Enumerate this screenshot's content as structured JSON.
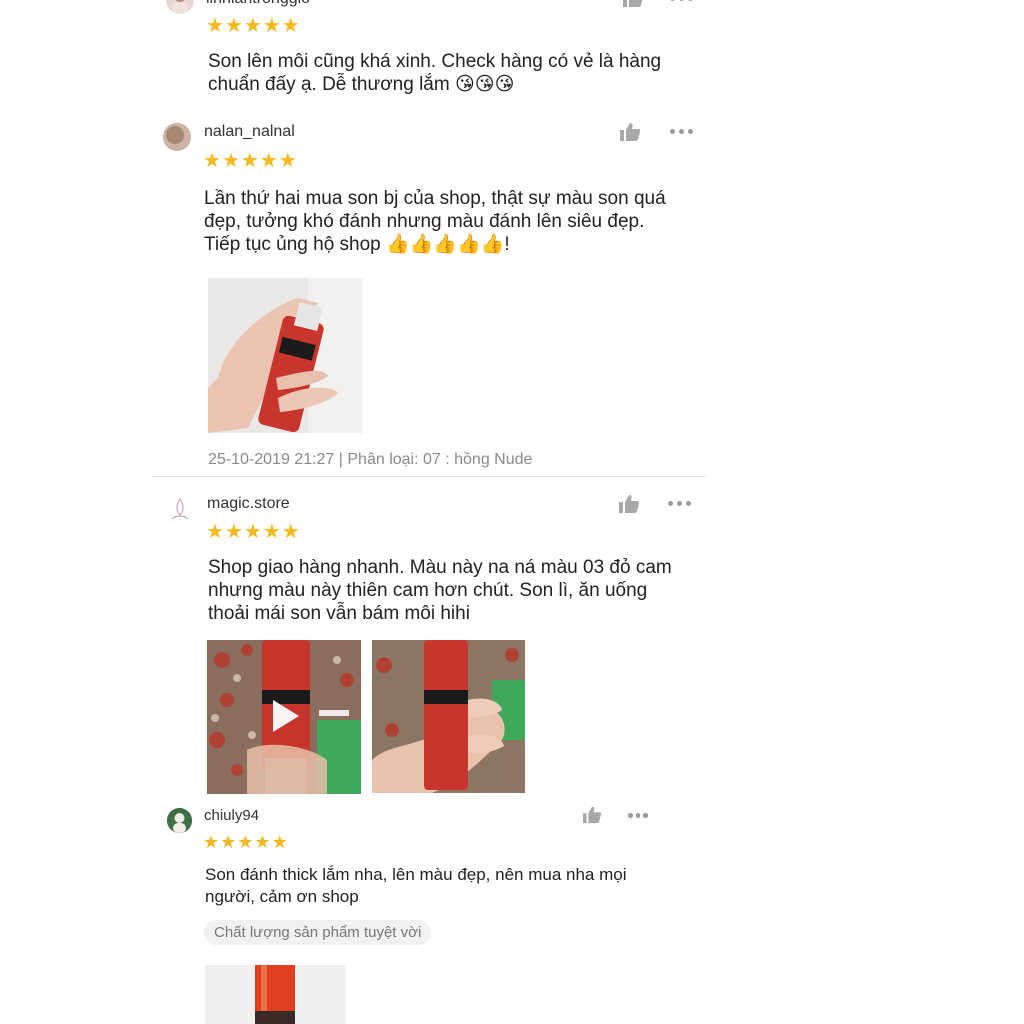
{
  "colors": {
    "star": "#f6b91c",
    "meta_text": "#8a8a8a",
    "lipstick_red": "#c8352c"
  },
  "reviews": [
    {
      "username": "linhlantronggio",
      "rating": 5,
      "text_lines": [
        "Son lên môi cũng khá xinh. Check hàng có vẻ là hàng",
        "chuẩn đấy ạ. Dễ thương lắm 😘😘😘"
      ]
    },
    {
      "username": "nalan_nalnal",
      "rating": 5,
      "text_lines": [
        "Lần thứ hai mua son bj của shop, thật sự màu son quá",
        "đẹp, tưởng khó đánh nhưng màu đánh lên siêu đẹp.",
        "Tiếp tục ủng hộ shop 👍👍👍👍👍!"
      ],
      "meta": "25-10-2019 21:27 | Phân loại: 07 : hồng Nude"
    },
    {
      "username": "magic.store",
      "rating": 5,
      "text_lines": [
        "Shop giao hàng nhanh. Màu này na ná màu 03 đỏ cam",
        "nhưng màu này thiên cam hơn chút. Son lì, ăn uống",
        "thoải mái son vẫn bám môi hihi"
      ]
    },
    {
      "username": "chiuly94",
      "rating": 5,
      "text_lines": [
        "Son đánh thick lắm nha, lên màu đẹp, nên mua nha mọi",
        "người, cảm ơn shop"
      ],
      "tag": "Chất lượng sản phẩm tuyệt vời"
    }
  ],
  "icons": {
    "like": "thumbs-up-icon",
    "more": "more-dots-icon",
    "star": "star-icon",
    "play": "play-icon"
  }
}
